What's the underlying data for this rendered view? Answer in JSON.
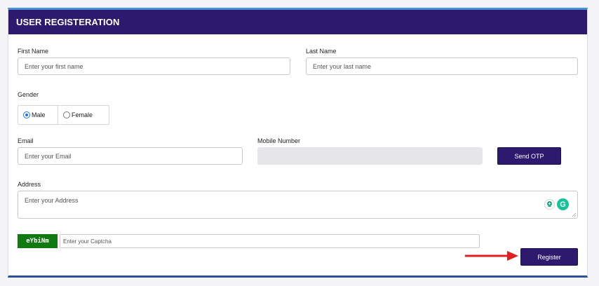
{
  "form": {
    "title": "USER REGISTERATION",
    "first_name": {
      "label": "First Name",
      "placeholder": "Enter your first name"
    },
    "last_name": {
      "label": "Last Name",
      "placeholder": "Enter your last name"
    },
    "gender": {
      "label": "Gender",
      "options": [
        "Male",
        "Female"
      ],
      "selected": "Male"
    },
    "email": {
      "label": "Email",
      "placeholder": "Enter your Email"
    },
    "mobile": {
      "label": "Mobile Number",
      "placeholder": ""
    },
    "send_otp_label": "Send OTP",
    "address": {
      "label": "Address",
      "placeholder": "Enter your Address"
    },
    "captcha": {
      "code": "eYbiNm",
      "placeholder": "Enter your Captcha"
    },
    "register_label": "Register"
  },
  "colors": {
    "header": "#2d1a6e",
    "button": "#2d1a6e",
    "captcha_bg": "#0f7a0f",
    "arrow": "#e02020",
    "radio_selected": "#1a73e8",
    "grammarly": "#15c39a"
  },
  "icons": {
    "address_extension_1": "pin-plus-icon",
    "address_extension_2": "grammarly-icon",
    "annotation": "red-arrow-icon"
  }
}
